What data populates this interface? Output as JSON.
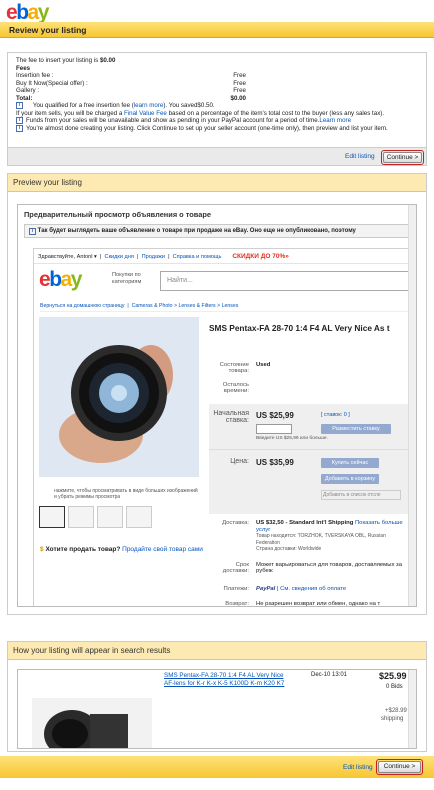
{
  "logo": {
    "letters": [
      "e",
      "b",
      "a",
      "y"
    ],
    "colors": [
      "#e53238",
      "#0064d2",
      "#f5af02",
      "#86b817"
    ]
  },
  "header": {
    "title": "Review your listing"
  },
  "fees": {
    "intro": "The fee to insert your listing is",
    "intro_amount": "$0.00",
    "heading": "Fees",
    "rows": [
      {
        "label": "Insertion fee :",
        "value": "Free"
      },
      {
        "label": "Buy It Now(Special offer) :",
        "value": "Free"
      },
      {
        "label": "Gallery :",
        "value": "Free"
      },
      {
        "label": "Total:",
        "value": "$0.00"
      }
    ],
    "notes": [
      {
        "pre": "You qualified for a free insertion fee (",
        "link": "learn more",
        "post": "). You saved$0.50."
      },
      {
        "pre": "If your item sells, you will be charged a ",
        "link": "Final Value Fee",
        "post": " based on a percentage of the item's total cost to the buyer (less any sales tax)."
      },
      {
        "pre": "Funds from your sales will be unavailable and show as pending in your PayPal account for a period of time.",
        "link": "Learn more",
        "post": ""
      }
    ],
    "almost": "You're almost done creating your listing. Click Continue to set up your seller account (one-time only), then preview and list your item."
  },
  "actions": {
    "edit": "Edit listing",
    "continue": "Continue >"
  },
  "preview": {
    "section_title": "Preview your listing",
    "title": "Предварительный просмотр объявления о товаре",
    "notice": "Так будет выглядеть ваше объявление о товаре при продаже на eBay. Оно еще не опубликовано, поэтому",
    "nav": [
      "Здравствуйте, Antonl",
      "Скидки дня",
      "Продажи",
      "Справка и помощь"
    ],
    "sale": "СКИДКИ ДО 70%»",
    "categories": "Покупки по категориям",
    "search_placeholder": "Найти...",
    "back": "Вернуться на домашнюю страницу",
    "breadcrumb": "Cameras & Photo > Lenses & Filters > Lenses",
    "item_title": "SMS Pentax-FA 28-70 1:4 F4 AL Very Nice As t",
    "condition_label": "Состояние товара:",
    "condition": "Used",
    "time_label": "Осталось времени:",
    "start_label": "Начальная ставка:",
    "start_price": "US $25,99",
    "bids": "[ ставок: 0 ]",
    "place_bid": "Разместить ставку",
    "bid_hint": "Введите US $25,99 или больше.",
    "price_label": "Цена:",
    "price": "US $35,99",
    "buy_now": "Купить сейчас",
    "add_cart": "Добавить в корзину",
    "watch": "Добавить в список отсле",
    "ship_label": "Доставка:",
    "ship_price": "US $32,50 - Standard Int'l Shipping",
    "ship_more": "Показать больше услуг",
    "ship_from": "Товар находится: TORZHOK, TVERSKAYA OBL, Russian Federation",
    "ship_to": "Страна доставки: Worldwide",
    "delivery_label": "Срок доставки:",
    "delivery": "Может варьироваться для товаров, доставляемых за рубеж",
    "pay_label": "Платежи:",
    "paypal": "PayPal",
    "pay_more": "См. сведения об оплате",
    "returns_label": "Возврат:",
    "returns": "Не разрешен возврат или обмен, однако на т",
    "zoom_hint": "нажмите, чтобы просматривать в виде больших изображений и убрать режимы просмотра",
    "sell": "Хотите продать товар?",
    "sell_link": "Продайте свой товар сами"
  },
  "search_result": {
    "section_title": "How your listing will appear in search results",
    "title": "SMS Pentax-FA 28-70 1:4 F4 AL Very Nice AF-lens for K-r K-x K-5 K100D K-m K20 K7",
    "date": "Dec-10 13:01",
    "price": "$25.99",
    "bids": "0 Bids",
    "shipping_price": "+$28.99",
    "shipping": "shipping"
  }
}
